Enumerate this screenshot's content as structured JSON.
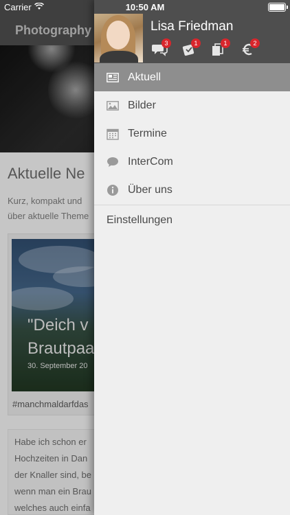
{
  "status_bar": {
    "carrier": "Carrier",
    "time": "10:50 AM"
  },
  "background_page": {
    "nav_title": "Photography",
    "heading": "Aktuelle Ne",
    "intro": "Kurz, kompakt und\nüber aktuelle Theme",
    "card": {
      "quote": "\"Deich v\nBrautpaa",
      "date": "30. September 20",
      "tag": "#manchmaldarfdas"
    },
    "text_excerpt": "Habe ich schon er\nHochzeiten in Dan\nder Knaller sind, be\nwenn man ein Brau\nwelches auch einfa"
  },
  "drawer": {
    "user_name": "Lisa Friedman",
    "header_icons": [
      {
        "icon": "chat-bubbles-icon",
        "badge": "3"
      },
      {
        "icon": "ticket-icon",
        "badge": "1"
      },
      {
        "icon": "documents-icon",
        "badge": "1"
      },
      {
        "icon": "euro-icon",
        "badge": "2"
      }
    ],
    "menu": [
      {
        "label": "Aktuell",
        "icon": "newspaper-icon",
        "active": true
      },
      {
        "label": "Bilder",
        "icon": "image-icon",
        "active": false
      },
      {
        "label": "Termine",
        "icon": "calendar-icon",
        "active": false
      },
      {
        "label": "InterCom",
        "icon": "speech-bubble-icon",
        "active": false
      },
      {
        "label": "Über uns",
        "icon": "info-icon",
        "active": false
      }
    ],
    "settings_label": "Einstellungen"
  },
  "colors": {
    "drawer_header_bg": "#4e4e4e",
    "active_item_bg": "#8e8e8e",
    "badge_red": "#d9262c",
    "nav_bg": "#4a4a4a"
  }
}
